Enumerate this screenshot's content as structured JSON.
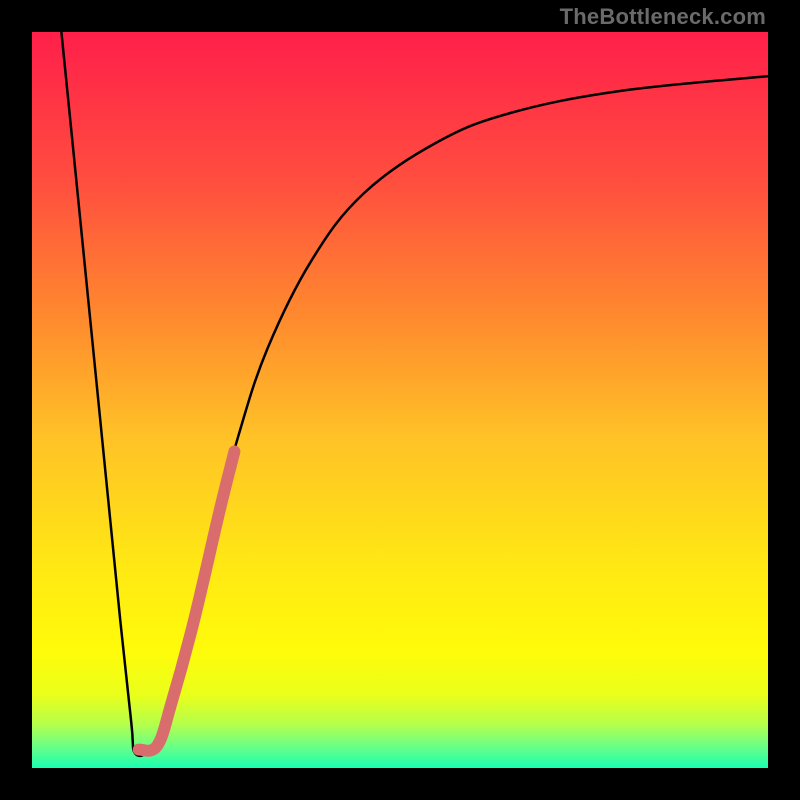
{
  "watermark": "TheBottleneck.com",
  "chart_data": {
    "type": "line",
    "title": "",
    "xlabel": "",
    "ylabel": "",
    "xlim": [
      0,
      100
    ],
    "ylim": [
      0,
      100
    ],
    "grid": false,
    "legend": false,
    "background_gradient_stops": [
      {
        "pos": 0.0,
        "color": "#ff1f4a"
      },
      {
        "pos": 0.2,
        "color": "#ff4d3f"
      },
      {
        "pos": 0.4,
        "color": "#ff8e2d"
      },
      {
        "pos": 0.55,
        "color": "#ffc227"
      },
      {
        "pos": 0.72,
        "color": "#ffe714"
      },
      {
        "pos": 0.84,
        "color": "#fffb0a"
      },
      {
        "pos": 0.9,
        "color": "#eaff1a"
      },
      {
        "pos": 0.94,
        "color": "#b6ff4a"
      },
      {
        "pos": 0.97,
        "color": "#6cff86"
      },
      {
        "pos": 1.0,
        "color": "#19ffb0"
      }
    ],
    "series": [
      {
        "name": "bottleneck-curve",
        "stroke": "#000000",
        "stroke_width": 2.5,
        "points": [
          {
            "x": 4.0,
            "y": 100.0
          },
          {
            "x": 6.0,
            "y": 80.0
          },
          {
            "x": 8.0,
            "y": 60.0
          },
          {
            "x": 10.0,
            "y": 40.0
          },
          {
            "x": 12.0,
            "y": 20.0
          },
          {
            "x": 13.5,
            "y": 6.0
          },
          {
            "x": 14.0,
            "y": 2.0
          },
          {
            "x": 16.0,
            "y": 2.5
          },
          {
            "x": 18.0,
            "y": 7.0
          },
          {
            "x": 20.0,
            "y": 14.0
          },
          {
            "x": 24.0,
            "y": 30.0
          },
          {
            "x": 28.0,
            "y": 45.0
          },
          {
            "x": 32.0,
            "y": 57.0
          },
          {
            "x": 38.0,
            "y": 69.0
          },
          {
            "x": 45.0,
            "y": 78.0
          },
          {
            "x": 55.0,
            "y": 85.0
          },
          {
            "x": 65.0,
            "y": 89.0
          },
          {
            "x": 80.0,
            "y": 92.0
          },
          {
            "x": 100.0,
            "y": 94.0
          }
        ]
      },
      {
        "name": "highlight-segment",
        "stroke": "#d96d6d",
        "stroke_width": 12,
        "linecap": "round",
        "points": [
          {
            "x": 14.5,
            "y": 2.5
          },
          {
            "x": 17.0,
            "y": 3.0
          },
          {
            "x": 19.0,
            "y": 9.0
          },
          {
            "x": 22.0,
            "y": 20.0
          },
          {
            "x": 25.5,
            "y": 35.0
          },
          {
            "x": 27.5,
            "y": 43.0
          }
        ]
      }
    ]
  }
}
